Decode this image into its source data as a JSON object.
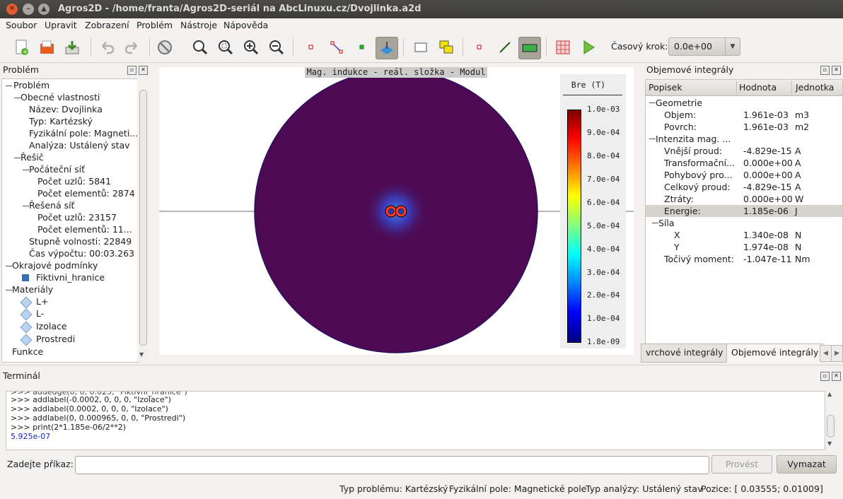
{
  "window": {
    "title": "Agros2D - /home/franta/Agros2D-seriál na AbcLinuxu.cz/Dvojlinka.a2d"
  },
  "menu": [
    "Soubor",
    "Upravit",
    "Zobrazení",
    "Problém",
    "Nástroje",
    "Nápověda"
  ],
  "toolbar": {
    "icons": [
      "new-document-icon",
      "open-folder-icon",
      "save-icon",
      "undo-icon",
      "redo-icon",
      "stop-icon",
      "zoom-best-fit-icon",
      "zoom-region-icon",
      "zoom-in-icon",
      "zoom-out-icon",
      "node-mode-icon",
      "edge-mode-icon",
      "label-mode-icon",
      "postprocessor-mode-icon",
      "rectangle-select-icon",
      "copy-icon",
      "node-marker-icon",
      "line-icon",
      "volume-integral-icon",
      "mesh-icon",
      "solve-icon"
    ],
    "time_step_label": "Časový krok:",
    "time_step_value": "0.0e+00"
  },
  "problem_dock": {
    "title": "Problém",
    "tree": {
      "root": "Problém",
      "general": "Obecné vlastnosti",
      "name": "Název: Dvojlinka",
      "type": "Typ: Kartézský",
      "field": "Fyzikální pole: Magneti...",
      "analysis": "Analýza: Ustálený stav",
      "solver": "Řešič",
      "initial_mesh": "Počáteční síť",
      "init_nodes": "Počet uzlů: 5841",
      "init_elements": "Počet elementů: 2874",
      "solved_mesh": "Řešená síť",
      "sol_nodes": "Počet uzlů: 23157",
      "sol_elements": "Počet elementů: 11...",
      "dof": "Stupně volnosti: 22849",
      "time": "Čas výpočtu: 00:03.263",
      "boundaries": "Okrajové podmínky",
      "boundary_1": "Fiktivni_hranice",
      "materials": "Materiály",
      "material_1": "L+",
      "material_2": "L-",
      "material_3": "Izolace",
      "material_4": "Prostredi",
      "functions": "Funkce"
    }
  },
  "view": {
    "title": "Mag. indukce - reál. složka - Modul",
    "legend_title": "Bre (T)",
    "ticks": [
      "1.0e-03",
      "9.0e-04",
      "8.0e-04",
      "7.0e-04",
      "6.0e-04",
      "5.0e-04",
      "4.0e-04",
      "3.0e-04",
      "2.0e-04",
      "1.0e-04",
      "1.8e-09"
    ]
  },
  "volume_integrals": {
    "title": "Objemové integrály",
    "columns": [
      "Popisek",
      "Hodnota",
      "Jednotka"
    ],
    "rows": [
      {
        "label": "Geometrie",
        "value": "",
        "unit": ""
      },
      {
        "label": "Objem:",
        "value": "1.961e-03",
        "unit": "m3"
      },
      {
        "label": "Povrch:",
        "value": "1.961e-03",
        "unit": "m2"
      },
      {
        "label": "Intenzita mag. ...",
        "value": "",
        "unit": ""
      },
      {
        "label": "Vnější proud:",
        "value": "-4.829e-15",
        "unit": "A"
      },
      {
        "label": "Transformační...",
        "value": "0.000e+00",
        "unit": "A"
      },
      {
        "label": "Pohybový pro...",
        "value": "0.000e+00",
        "unit": "A"
      },
      {
        "label": "Celkový proud:",
        "value": "-4.829e-15",
        "unit": "A"
      },
      {
        "label": "Ztráty:",
        "value": "0.000e+00",
        "unit": "W"
      },
      {
        "label": "Energie:",
        "value": "1.185e-06",
        "unit": "J"
      },
      {
        "label": "Síla",
        "value": "",
        "unit": ""
      },
      {
        "label": "X",
        "value": "1.340e-08",
        "unit": "N"
      },
      {
        "label": "Y",
        "value": "1.974e-08",
        "unit": "N"
      },
      {
        "label": "Točivý moment:",
        "value": "-1.047e-11",
        "unit": "Nm"
      }
    ],
    "tabs": [
      "vrchové integrály",
      "Objemové integrály"
    ]
  },
  "terminal": {
    "title": "Terminál",
    "lines": [
      ">>> addlabel(-0.0002, 0, 0, 0, \"Izolace\")",
      ">>> addlabel(0.0002, 0, 0, 0, \"Izolace\")",
      ">>> addlabel(0, 0.000965, 0, 0, \"Prostredi\")",
      ">>> print(2*1.185e-06/2**2)",
      "5.925e-07"
    ],
    "command_label": "Zadejte příkaz:",
    "command_value": "",
    "run_button": "Provést",
    "clear_button": "Vymazat"
  },
  "status": {
    "problem_type": "Typ problému: Kartézský",
    "field": "Fyzikální pole: Magnetické pole",
    "analysis": "Typ analýzy: Ustálený stav",
    "position": "Pozice: [ 0.03555;  0.01009]"
  }
}
